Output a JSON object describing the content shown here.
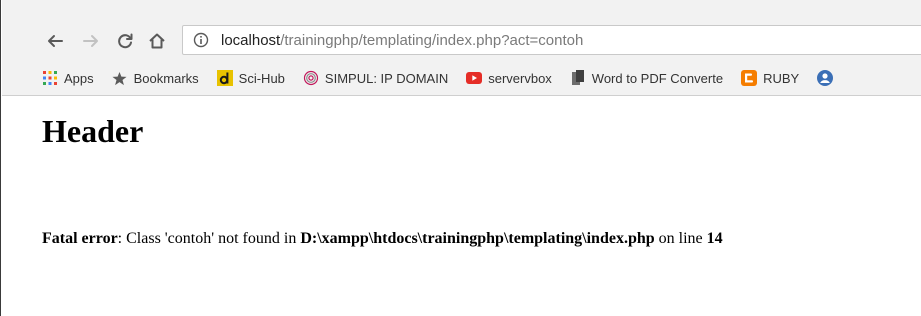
{
  "browser": {
    "url_host": "localhost",
    "url_path": "/trainingphp/templating/index.php?act=contoh",
    "bookmarks": [
      {
        "label": "Apps",
        "icon": "apps-grid-icon"
      },
      {
        "label": "Bookmarks",
        "icon": "star-icon"
      },
      {
        "label": "Sci-Hub",
        "icon": "scihub-d-icon"
      },
      {
        "label": "SIMPUL: IP DOMAIN",
        "icon": "fingerprint-icon"
      },
      {
        "label": "servervbox",
        "icon": "youtube-icon"
      },
      {
        "label": "Word to PDF Converte",
        "icon": "converter-icon"
      },
      {
        "label": "RUBY",
        "icon": "blogger-icon"
      }
    ]
  },
  "page": {
    "heading": "Header",
    "error": {
      "prefix": "Fatal error",
      "message": ": Class 'contoh' not found in ",
      "file": "D:\\xampp\\htdocs\\trainingphp\\templating\\index.php",
      "middle": " on line ",
      "line": "14"
    }
  },
  "colors": {
    "youtube_red": "#e52d27",
    "blogger_orange": "#f57d00",
    "scihub_yellow": "#e8c200",
    "apps_red": "#e94235",
    "apps_yellow": "#fbbc04",
    "apps_green": "#34a853",
    "apps_blue": "#4285f4"
  }
}
